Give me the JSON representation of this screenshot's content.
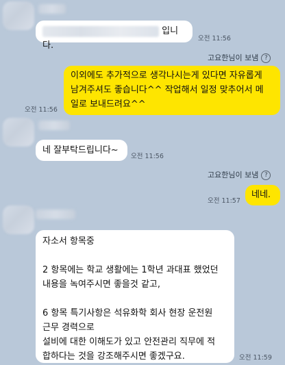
{
  "messages": {
    "m1": {
      "text": "입니다.",
      "time": "오전 11:56"
    },
    "m2": {
      "sender": "고요한님이 보냄",
      "lines": [
        "이외에도 추가적으로 생각나시는게 있다면 자유롭게",
        "남겨주셔도 좋습니다^^ 작업해서 일정 맞추어서 메",
        "일로 보내드려요^^"
      ],
      "time": "오전 11:56"
    },
    "m3": {
      "text": "네 잘부탁드립니다~",
      "time": "오전 11:56"
    },
    "m4": {
      "sender": "고요한님이 보냄",
      "text": "네네.",
      "time": "오전 11:57"
    },
    "m5": {
      "lines": [
        "자소서 항목중",
        "",
        "2 항목에는 학교 생활에는 1학년 과대표 했었던",
        "내용을 녹여주시면 좋을것 같고,",
        "",
        "6 항목 특기사항은 석유화학 회사 현장 운전원",
        "근무 경력으로",
        "설비에 대한 이해도가 있고 안전관리 직무에 적",
        "합하다는 것을 강조해주시면 좋겠구요."
      ],
      "time": "오전 11:59"
    }
  },
  "icons": {
    "help": "question-circle-icon"
  },
  "colors": {
    "background": "#b9c8d9",
    "incoming": "#ffffff",
    "outgoing": "#fee500"
  }
}
